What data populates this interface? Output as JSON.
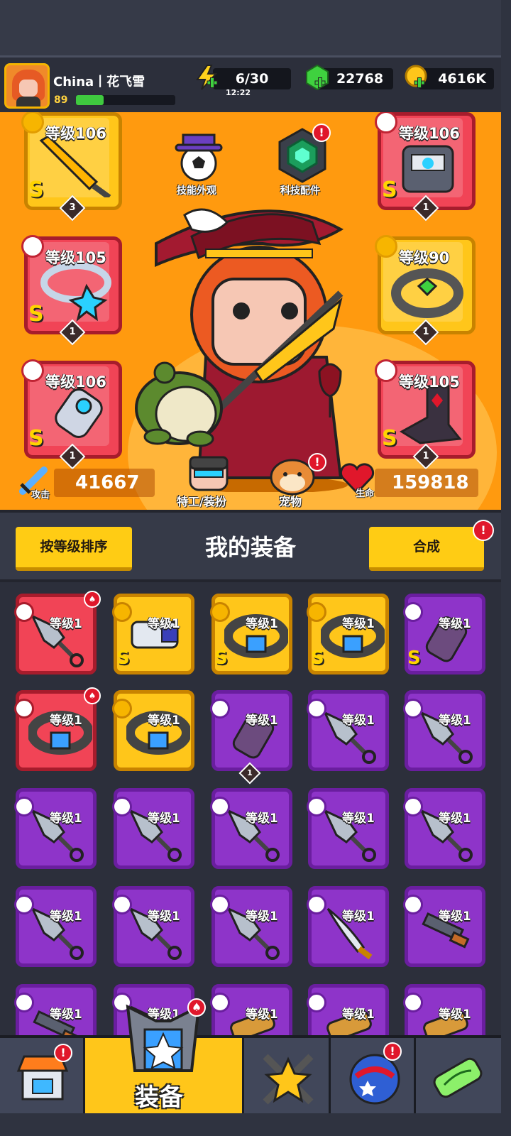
{
  "player": {
    "name": "China丨花飞雪",
    "level": "89",
    "xp_fraction": 0.28
  },
  "resources": {
    "energy": "6/30",
    "energy_timer": "12:22",
    "gems": "22768",
    "gold": "4616K"
  },
  "hero_menu": {
    "skin_label": "技能外观",
    "tech_label": "科技配件",
    "agent_label": "特工/装扮",
    "pet_label": "宠物"
  },
  "equipped": [
    {
      "level": "等级106",
      "grade": "S",
      "count": "3"
    },
    {
      "level": "等级105",
      "grade": "S",
      "count": "1"
    },
    {
      "level": "等级106",
      "grade": "S",
      "count": "1"
    },
    {
      "level": "等级106",
      "grade": "S",
      "count": "1"
    },
    {
      "level": "等级90",
      "grade": "",
      "count": "1"
    },
    {
      "level": "等级105",
      "grade": "S",
      "count": "1"
    }
  ],
  "stats": {
    "attack_label": "攻击",
    "attack": "41667",
    "hp_label": "生命",
    "hp": "159818"
  },
  "equipment_panel": {
    "sort_button": "按等级排序",
    "title": "我的装备",
    "merge_button": "合成"
  },
  "inventory": {
    "level_label": "等级1",
    "grade_label": "S",
    "count_label": "1"
  },
  "nav": {
    "active_label": "装备"
  },
  "colors": {
    "stage": "#ff9a0f",
    "purple": "#8e34c9",
    "red": "#f14456",
    "gold": "#ffc61a"
  }
}
